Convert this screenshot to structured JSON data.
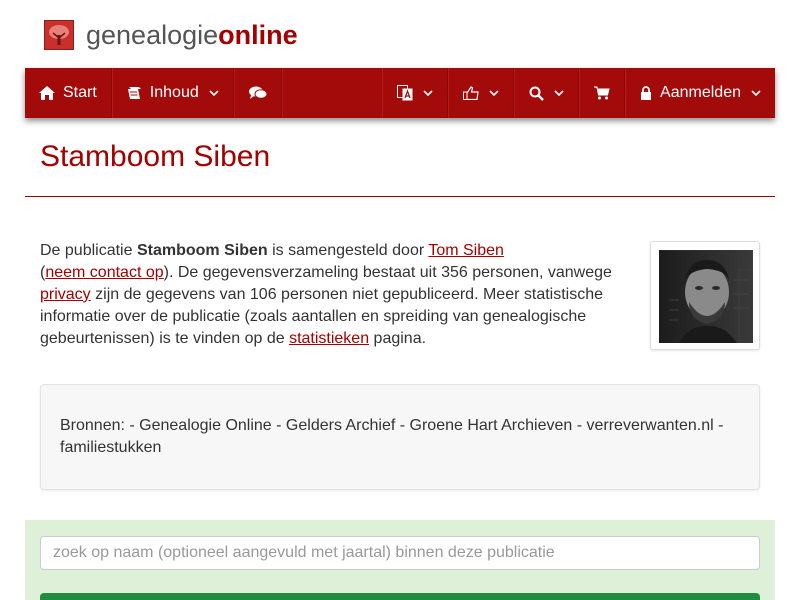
{
  "brand": {
    "part1": "genealogie",
    "part2": "online"
  },
  "nav": {
    "start_label": "Start",
    "inhoud_label": "Inhoud",
    "login_label": "Aanmelden"
  },
  "page": {
    "title": "Stamboom Siben"
  },
  "intro": {
    "t1": "De publicatie ",
    "pub_name": "Stamboom Siben",
    "t2": " is samengesteld door ",
    "author_link": "Tom Siben",
    "t3": "(",
    "contact_link": "neem contact op",
    "t4": "). De gegevensverzameling bestaat uit 356 personen, vanwege ",
    "privacy_link": "privacy",
    "t5": " zijn de gegevens van 106 personen niet gepubliceerd. Meer statistische informatie over de publicatie (zoals aantallen en spreiding van genealogische gebeurtenissen) is te vinden op de ",
    "stats_link": "statistieken",
    "t6": " pagina."
  },
  "sources": {
    "text": "Bronnen: - Genealogie Online - Gelders Archief - Groene Hart Archieven - verreverwanten.nl - familiestukken"
  },
  "search": {
    "placeholder": "zoek op naam (optioneel aangevuld met jaartal) binnen deze publicatie"
  },
  "colors": {
    "brand_red": "#a50000",
    "navbar": "#a30a0a",
    "search_bg": "#dff0d8",
    "search_button": "#1e8e3e"
  }
}
